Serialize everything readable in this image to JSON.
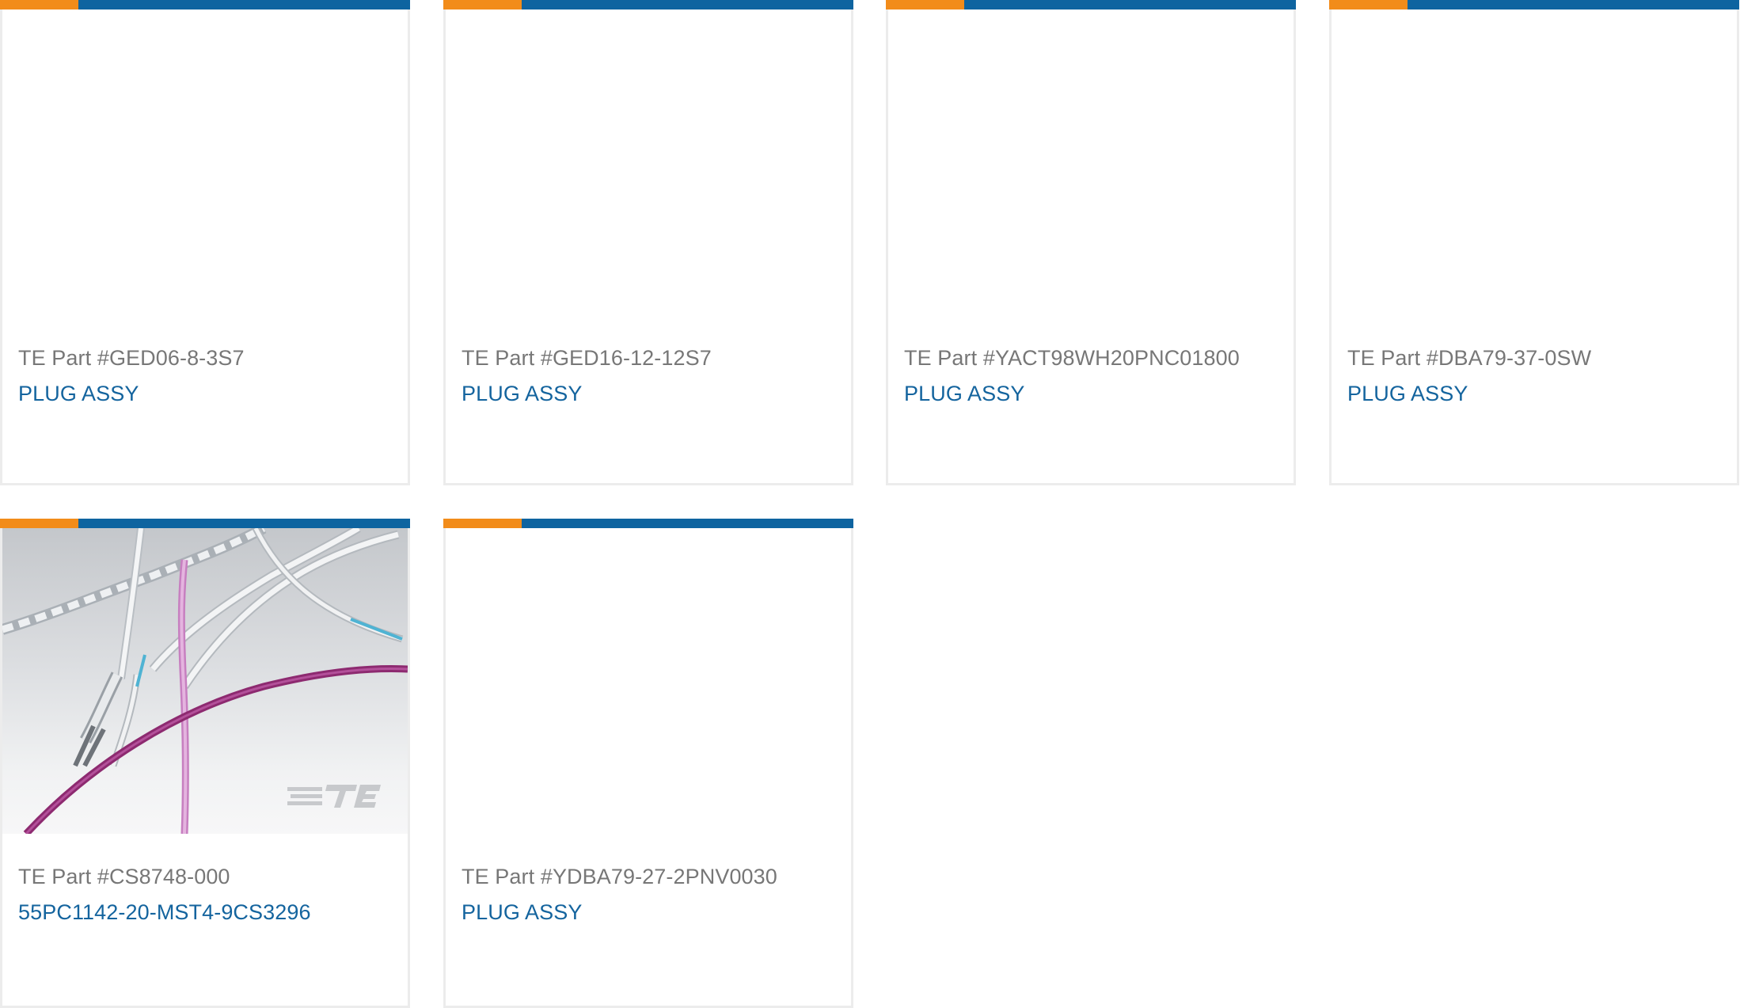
{
  "colors": {
    "accent_orange": "#f28c1a",
    "accent_blue": "#0e64a0",
    "link_blue": "#14649e",
    "text_gray": "#777777",
    "card_border": "#ececec"
  },
  "cards": [
    {
      "part_number": "TE Part #GED06-8-3S7",
      "name": "PLUG ASSY",
      "has_image": false
    },
    {
      "part_number": "TE Part #GED16-12-12S7",
      "name": "PLUG ASSY",
      "has_image": false
    },
    {
      "part_number": "TE Part #YACT98WH20PNC01800",
      "name": "PLUG ASSY",
      "has_image": false
    },
    {
      "part_number": "TE Part #DBA79-37-0SW",
      "name": "PLUG ASSY",
      "has_image": false
    },
    {
      "part_number": "TE Part #CS8748-000",
      "name": "55PC1142-20-MST4-9CS3296",
      "has_image": true,
      "image_icon": "wire-cable-product-image"
    },
    {
      "part_number": "TE Part #YDBA79-27-2PNV0030",
      "name": "PLUG ASSY",
      "has_image": false
    }
  ]
}
